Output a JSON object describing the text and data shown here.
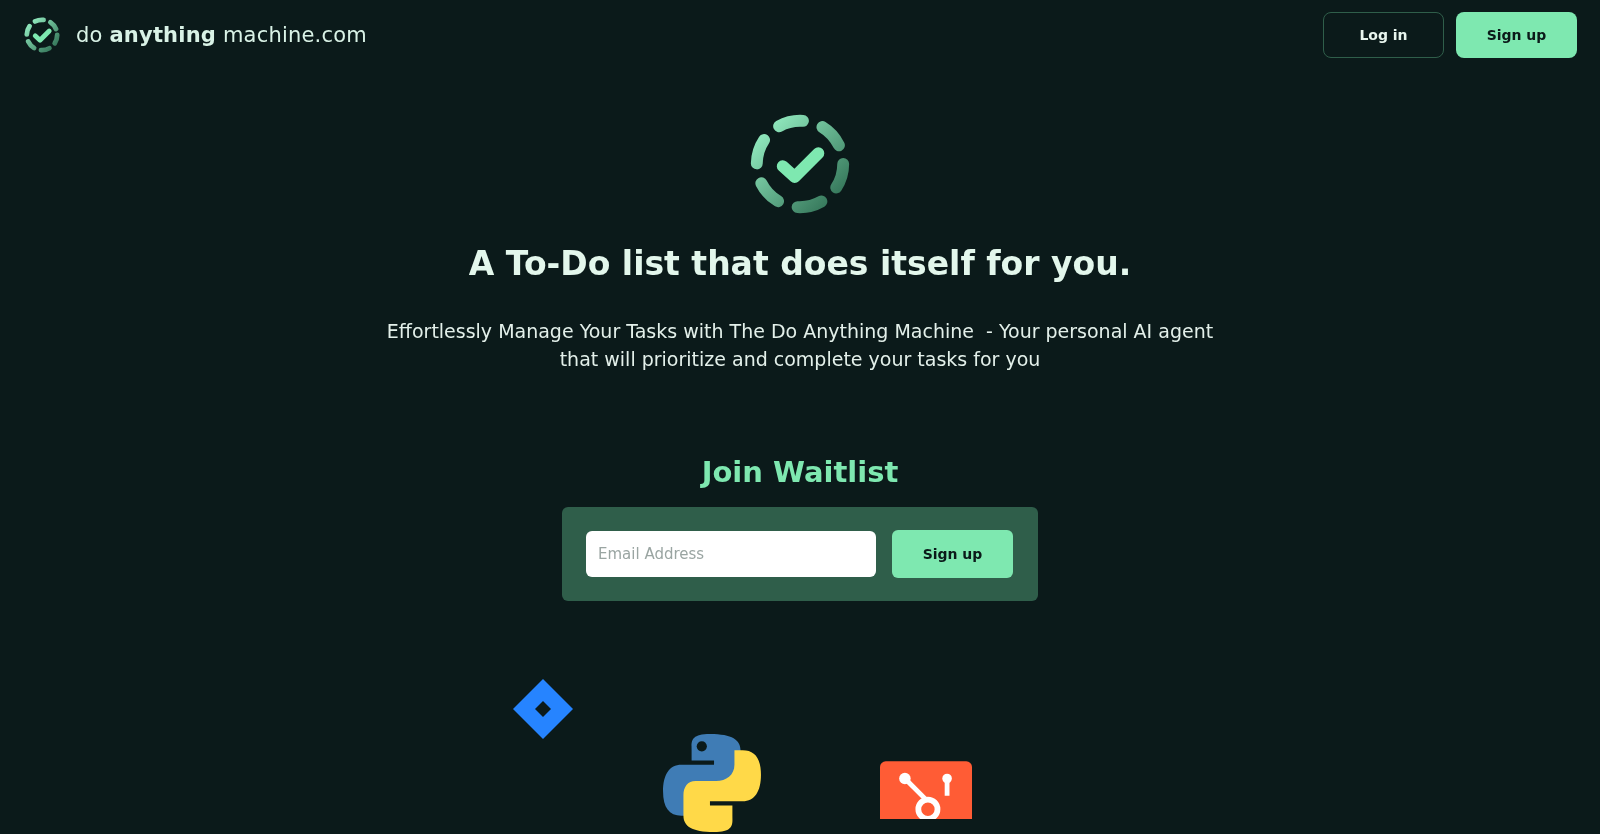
{
  "header": {
    "logo_text": "do **anything** machine.com",
    "buttons": [
      {
        "label": "Log in",
        "kind": "outline"
      },
      {
        "label": "Sign up",
        "kind": "filled"
      }
    ]
  },
  "hero": {
    "headline": "A To-Do list that does itself for you.",
    "subtitle_lines": [
      "Effortlessly Manage Your Tasks with The Do Anything Machine  - Your personal AI agent",
      "that will prioritize and complete your tasks for you"
    ]
  },
  "waitlist": {
    "title": "Join Waitlist",
    "email": {
      "placeholder": "Email Address"
    },
    "button": "Sign up"
  }
}
